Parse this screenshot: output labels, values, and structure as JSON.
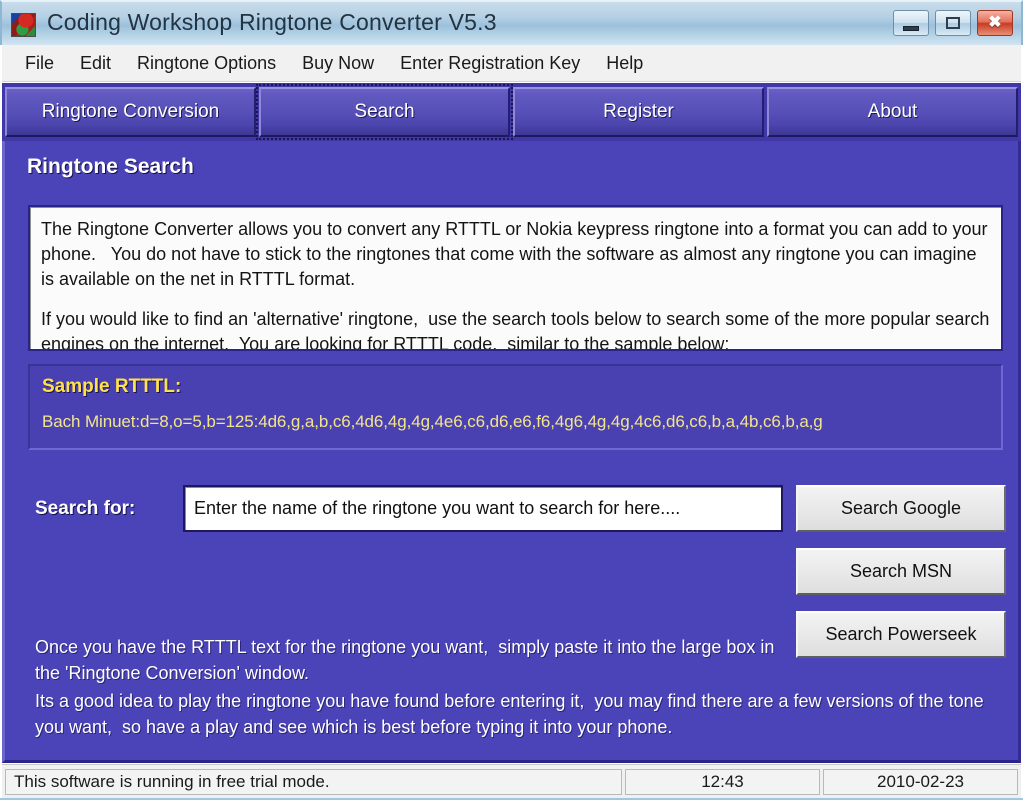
{
  "window": {
    "title": "Coding Workshop Ringtone Converter V5.3",
    "icon": "app-logo-icon",
    "controls": {
      "minimize": "minimize-icon",
      "maximize": "maximize-icon",
      "close": "✖"
    }
  },
  "menubar": {
    "items": [
      {
        "label": "File"
      },
      {
        "label": "Edit"
      },
      {
        "label": "Ringtone Options"
      },
      {
        "label": "Buy Now"
      },
      {
        "label": "Enter Registration Key"
      },
      {
        "label": "Help"
      }
    ]
  },
  "tabs": [
    {
      "label": "Ringtone Conversion",
      "selected": false
    },
    {
      "label": "Search",
      "selected": true
    },
    {
      "label": "Register",
      "selected": false
    },
    {
      "label": "About",
      "selected": false
    }
  ],
  "panel": {
    "title": "Ringtone Search",
    "description": [
      "The Ringtone Converter allows you to convert any RTTTL or Nokia keypress ringtone into a format you can add to your phone.   You do not have to stick to the ringtones that come with the software as almost any ringtone you can imagine is available on the net in RTTTL format.",
      "If you would like to find an 'alternative' ringtone,  use the search tools below to search some of the more popular search engines on the internet.  You are looking for RTTTL code,  similar to the sample below:"
    ],
    "sample": {
      "heading": "Sample RTTTL:",
      "code": "Bach Minuet:d=8,o=5,b=125:4d6,g,a,b,c6,4d6,4g,4g,4e6,c6,d6,e6,f6,4g6,4g,4g,4c6,d6,c6,b,a,4b,c6,b,a,g"
    },
    "search": {
      "label": "Search for:",
      "value": "",
      "placeholder": "Enter the name of the ringtone you want to search for here....",
      "buttons": [
        {
          "label": "Search Google"
        },
        {
          "label": "Search MSN"
        },
        {
          "label": "Search Powerseek"
        }
      ]
    },
    "notes": [
      "Once you have the RTTTL text for the ringtone you want,  simply paste it into the large box in the 'Ringtone Conversion' window.",
      "Its a good idea to play the ringtone you have found before entering it,  you may find there are a few versions of the tone you want,  so have a play and see which is best before typing it into your phone."
    ]
  },
  "statusbar": {
    "message": "This software is running in free trial mode.",
    "time": "12:43",
    "date": "2010-02-23"
  },
  "colors": {
    "panel_purple": "#4b43b8",
    "tab_purple": "#5650b8",
    "sample_yellow": "#ffe14d",
    "titlebar_blue": "#9cc1dc"
  }
}
